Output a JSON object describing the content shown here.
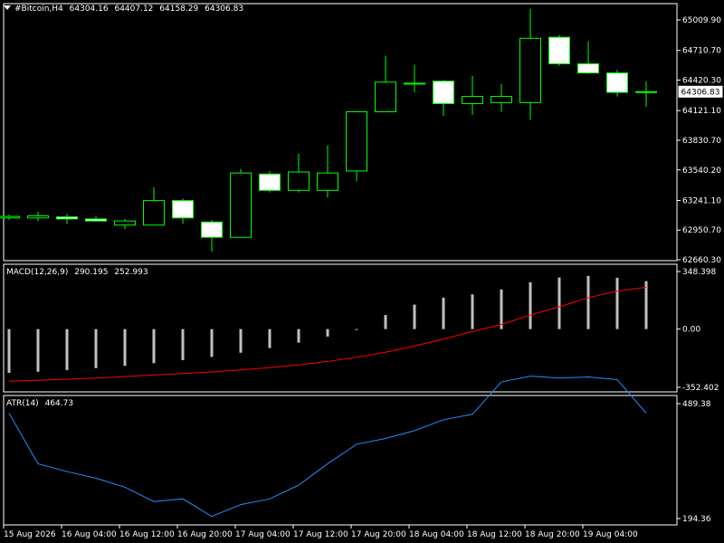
{
  "header": {
    "symbol": "#Bitcoin,H4",
    "open": "64304.16",
    "high": "64407.12",
    "low": "64158.29",
    "close": "64306.83",
    "menu_icon": "triangle-down-icon"
  },
  "macd": {
    "label": "MACD(12,26,9)",
    "main": "290.195",
    "signal": "252.993"
  },
  "atr": {
    "label": "ATR(14)",
    "value": "464.73"
  },
  "colors": {
    "background": "#000000",
    "grid": "#ffffff",
    "bull_outline": "#00ff00",
    "bull_body": "#000000",
    "bear_body": "#ffffff",
    "macd_hist": "#c0c0c0",
    "macd_signal": "#ff0000",
    "atr_line": "#1e90ff"
  },
  "chart_data": [
    {
      "type": "candlestick",
      "y_ticks": [
        "65009.90",
        "64710.70",
        "64420.30",
        "64121.10",
        "63830.70",
        "63540.20",
        "63241.10",
        "62950.70",
        "62660.30"
      ],
      "ylim": [
        62660.3,
        65009.9
      ],
      "current_price_label": "64306.83",
      "x_ticks": [
        "15 Aug 2026",
        "16 Aug 04:00",
        "16 Aug 12:00",
        "16 Aug 20:00",
        "17 Aug 04:00",
        "17 Aug 12:00",
        "17 Aug 20:00",
        "18 Aug 04:00",
        "18 Aug 12:00",
        "18 Aug 20:00",
        "19 Aug 04:00"
      ],
      "candles": [
        {
          "o": 63070,
          "h": 63100,
          "l": 63050,
          "c": 63085
        },
        {
          "o": 63070,
          "h": 63130,
          "l": 63040,
          "c": 63090
        },
        {
          "o": 63080,
          "h": 63110,
          "l": 63010,
          "c": 63060
        },
        {
          "o": 63060,
          "h": 63090,
          "l": 63030,
          "c": 63040
        },
        {
          "o": 63000,
          "h": 63060,
          "l": 62960,
          "c": 63040
        },
        {
          "o": 63000,
          "h": 63370,
          "l": 63000,
          "c": 63240
        },
        {
          "o": 63240,
          "h": 63260,
          "l": 63010,
          "c": 63070
        },
        {
          "o": 63030,
          "h": 63050,
          "l": 62740,
          "c": 62880
        },
        {
          "o": 62880,
          "h": 63550,
          "l": 62880,
          "c": 63510
        },
        {
          "o": 63500,
          "h": 63530,
          "l": 63320,
          "c": 63340
        },
        {
          "o": 63340,
          "h": 63700,
          "l": 63320,
          "c": 63520
        },
        {
          "o": 63340,
          "h": 63780,
          "l": 63270,
          "c": 63510
        },
        {
          "o": 63530,
          "h": 64110,
          "l": 63430,
          "c": 64110
        },
        {
          "o": 64110,
          "h": 64660,
          "l": 64110,
          "c": 64400
        },
        {
          "o": 64390,
          "h": 64570,
          "l": 64300,
          "c": 64390
        },
        {
          "o": 64410,
          "h": 64420,
          "l": 64070,
          "c": 64190
        },
        {
          "o": 64190,
          "h": 64460,
          "l": 64080,
          "c": 64260
        },
        {
          "o": 64200,
          "h": 64380,
          "l": 64110,
          "c": 64260
        },
        {
          "o": 64200,
          "h": 65120,
          "l": 64030,
          "c": 64830
        },
        {
          "o": 64840,
          "h": 64860,
          "l": 64560,
          "c": 64580
        },
        {
          "o": 64580,
          "h": 64800,
          "l": 64480,
          "c": 64490
        },
        {
          "o": 64490,
          "h": 64520,
          "l": 64260,
          "c": 64300
        },
        {
          "o": 64305,
          "h": 64407,
          "l": 64158,
          "c": 64307
        }
      ]
    },
    {
      "type": "bar",
      "name": "MACD(12,26,9)",
      "y_ticks": [
        "348.398",
        "0.00",
        "-352.402"
      ],
      "ylim": [
        -352.402,
        348.398
      ],
      "histogram": [
        -265,
        -258,
        -248,
        -236,
        -222,
        -206,
        -188,
        -168,
        -143,
        -115,
        -82,
        -45,
        -3,
        85,
        148,
        190,
        210,
        240,
        283,
        312,
        322,
        310,
        290
      ],
      "signal": [
        -315,
        -310,
        -303,
        -296,
        -287,
        -278,
        -269,
        -259,
        -247,
        -233,
        -217,
        -196,
        -170,
        -140,
        -102,
        -60,
        -15,
        28,
        85,
        135,
        190,
        230,
        253
      ]
    },
    {
      "type": "line",
      "name": "ATR(14)",
      "y_ticks": [
        "489.38",
        "194.36"
      ],
      "ylim": [
        194.36,
        489.38
      ],
      "values": [
        465,
        335,
        315,
        298,
        275,
        238,
        245,
        200,
        230,
        245,
        280,
        335,
        385,
        400,
        420,
        448,
        462,
        545,
        560,
        555,
        558,
        551,
        465
      ]
    }
  ]
}
